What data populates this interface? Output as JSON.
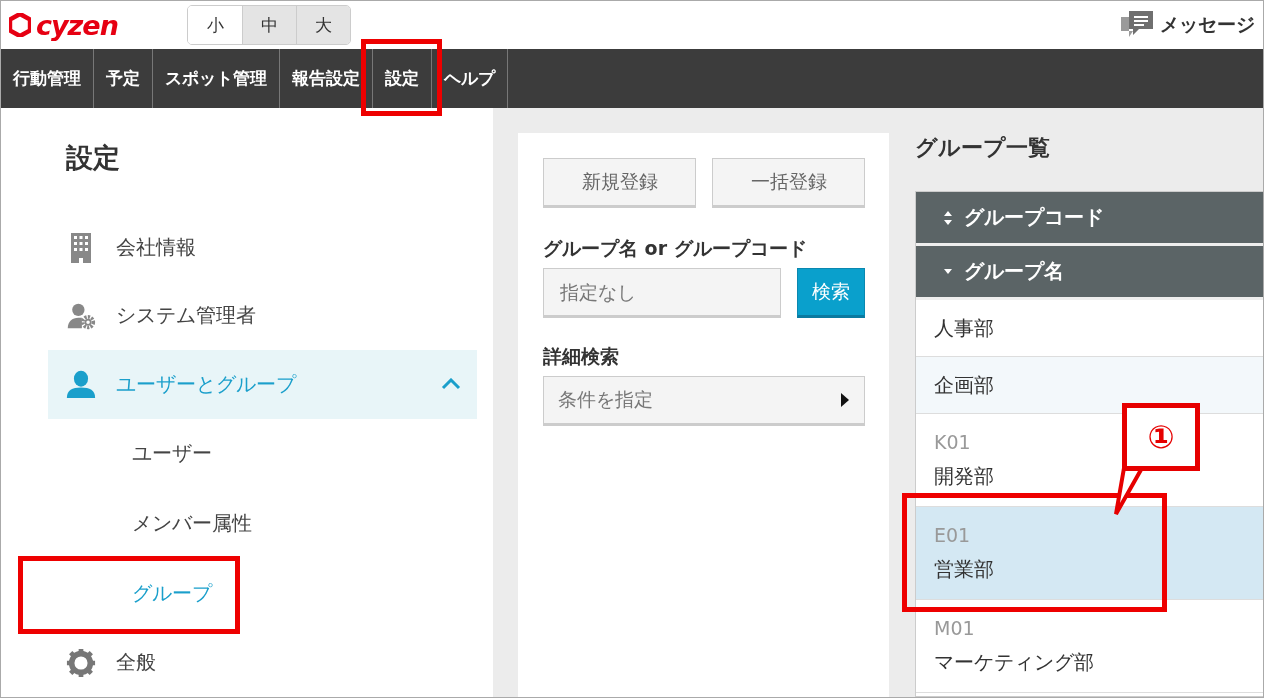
{
  "header": {
    "logo": "cyzen",
    "font_sizes": [
      {
        "label": "小",
        "selected": true
      },
      {
        "label": "中",
        "selected": false
      },
      {
        "label": "大",
        "selected": false
      }
    ],
    "messages": "メッセージ"
  },
  "nav": [
    {
      "label": "行動管理",
      "highlighted": false
    },
    {
      "label": "予定",
      "highlighted": false
    },
    {
      "label": "スポット管理",
      "highlighted": false
    },
    {
      "label": "報告設定",
      "highlighted": false
    },
    {
      "label": "設定",
      "highlighted": true
    },
    {
      "label": "ヘルプ",
      "highlighted": false
    }
  ],
  "sidebar": {
    "title": "設定",
    "items": [
      {
        "label": "会社情報",
        "kind": "building",
        "selected": false
      },
      {
        "label": "システム管理者",
        "kind": "admin",
        "selected": false
      },
      {
        "label": "ユーザーとグループ",
        "kind": "user",
        "selected": true,
        "expanded": true,
        "children": [
          {
            "label": "ユーザー",
            "selected": false,
            "highlighted": false
          },
          {
            "label": "メンバー属性",
            "selected": false,
            "highlighted": false
          },
          {
            "label": "グループ",
            "selected": true,
            "highlighted": true
          }
        ]
      },
      {
        "label": "全般",
        "kind": "gear",
        "selected": false
      }
    ]
  },
  "search": {
    "buttons": [
      "新規登録",
      "一括登録"
    ],
    "field_label": "グループ名 or グループコード",
    "placeholder": "指定なし",
    "search_button": "検索",
    "detail_label": "詳細検索",
    "detail_dropdown": "条件を指定"
  },
  "group_list": {
    "title": "グループ一覧",
    "columns": [
      {
        "label": "グループコード",
        "sorted": false
      },
      {
        "label": "グループ名",
        "sorted": true
      }
    ],
    "rows": [
      {
        "name": "人事部",
        "selected": false,
        "highlighted": false
      },
      {
        "name": "企画部",
        "selected": false,
        "highlighted": false
      },
      {
        "code": "K01",
        "name": "開発部",
        "selected": false,
        "highlighted": false
      },
      {
        "code": "E01",
        "name": "営業部",
        "selected": true,
        "highlighted": true,
        "callout": "①"
      },
      {
        "code": "M01",
        "name": "マーケティング部",
        "selected": false,
        "highlighted": false
      }
    ]
  }
}
